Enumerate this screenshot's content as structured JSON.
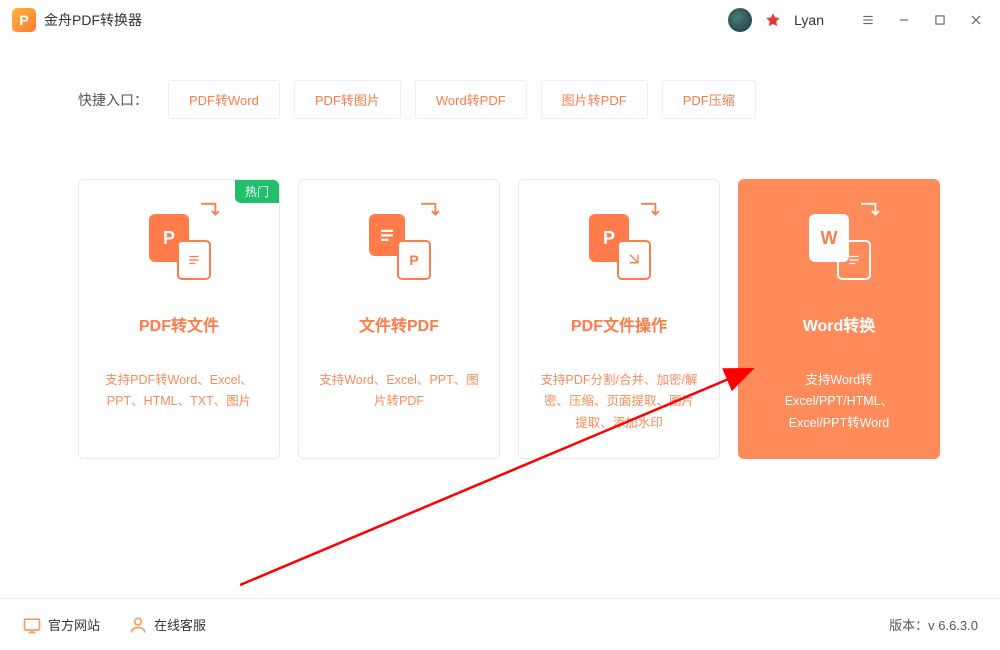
{
  "app": {
    "title": "金舟PDF转换器",
    "logo_letter": "P"
  },
  "user": {
    "name": "Lyan"
  },
  "quick": {
    "label": "快捷入口：",
    "items": [
      "PDF转Word",
      "PDF转图片",
      "Word转PDF",
      "图片转PDF",
      "PDF压缩"
    ]
  },
  "cards": [
    {
      "title": "PDF转文件",
      "desc": "支持PDF转Word、Excel、PPT、HTML、TXT、图片",
      "hot": "热门",
      "icon_a": "P",
      "active": false
    },
    {
      "title": "文件转PDF",
      "desc": "支持Word、Excel、PPT、图片转PDF",
      "icon_a": "≡",
      "icon_b": "P",
      "active": false
    },
    {
      "title": "PDF文件操作",
      "desc": "支持PDF分割/合并、加密/解密、压缩、页面提取、图片提取、添加水印",
      "icon_a": "P",
      "active": false
    },
    {
      "title": "Word转换",
      "desc": "支持Word转Excel/PPT/HTML、Excel/PPT转Word",
      "icon_a": "W",
      "active": true
    }
  ],
  "footer": {
    "site": "官方网站",
    "support": "在线客服",
    "version_label": "版本：",
    "version": "v 6.6.3.0"
  }
}
